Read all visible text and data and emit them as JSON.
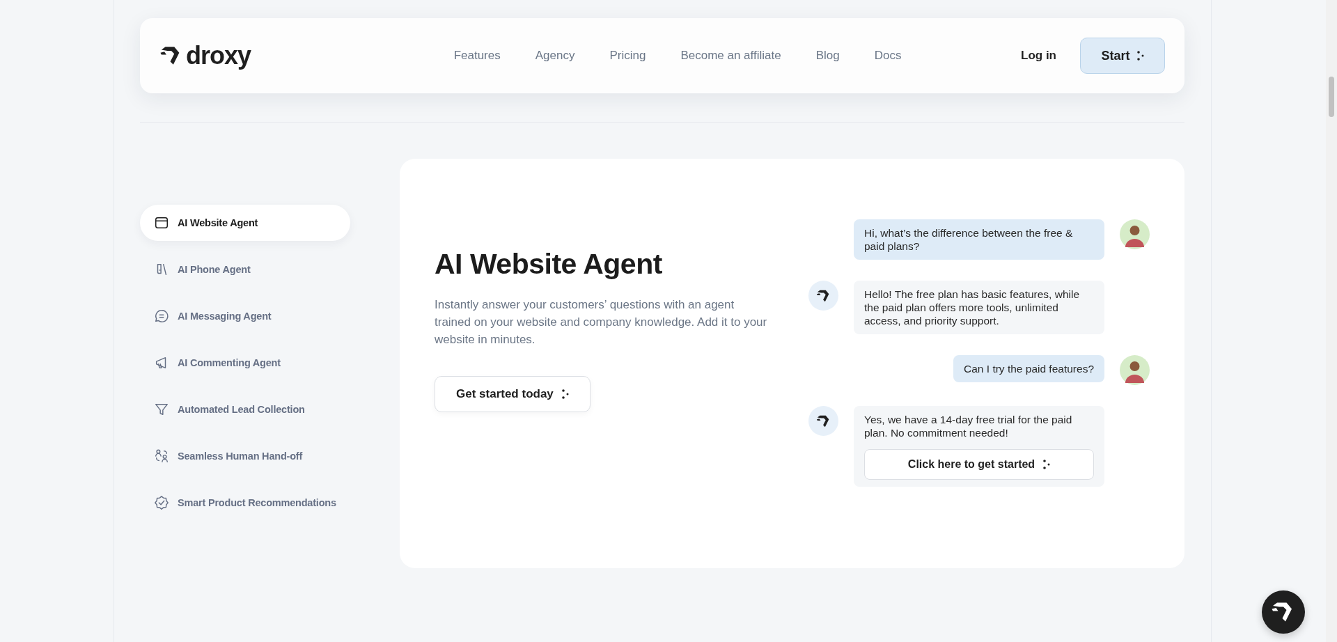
{
  "header": {
    "logo": "droxy",
    "nav": [
      "Features",
      "Agency",
      "Pricing",
      "Become an affiliate",
      "Blog",
      "Docs"
    ],
    "login": "Log in",
    "start": "Start"
  },
  "sidebar": {
    "items": [
      {
        "label": "AI Website Agent",
        "selected": true
      },
      {
        "label": "AI Phone Agent",
        "selected": false
      },
      {
        "label": "AI Messaging Agent",
        "selected": false
      },
      {
        "label": "AI Commenting Agent",
        "selected": false
      },
      {
        "label": "Automated Lead Collection",
        "selected": false
      },
      {
        "label": "Seamless Human Hand-off",
        "selected": false
      },
      {
        "label": "Smart Product Recommendations",
        "selected": false
      }
    ]
  },
  "hero": {
    "title": "AI Website Agent",
    "description": "Instantly answer your customers’ questions with an agent trained on your website and company knowledge. Add it to your website in minutes.",
    "cta": "Get started today"
  },
  "chat": {
    "messages": [
      {
        "kind": "user",
        "text": "Hi, what’s the difference between the free & paid plans?"
      },
      {
        "kind": "bot",
        "text": "Hello! The free plan has basic features, while the paid plan offers more tools, unlimited access, and priority support."
      },
      {
        "kind": "user",
        "text": "Can I try the paid features?"
      },
      {
        "kind": "bot",
        "text": "Yes, we have a 14-day free trial for the paid plan. No commitment needed!",
        "button": "Click here to get started"
      }
    ]
  }
}
